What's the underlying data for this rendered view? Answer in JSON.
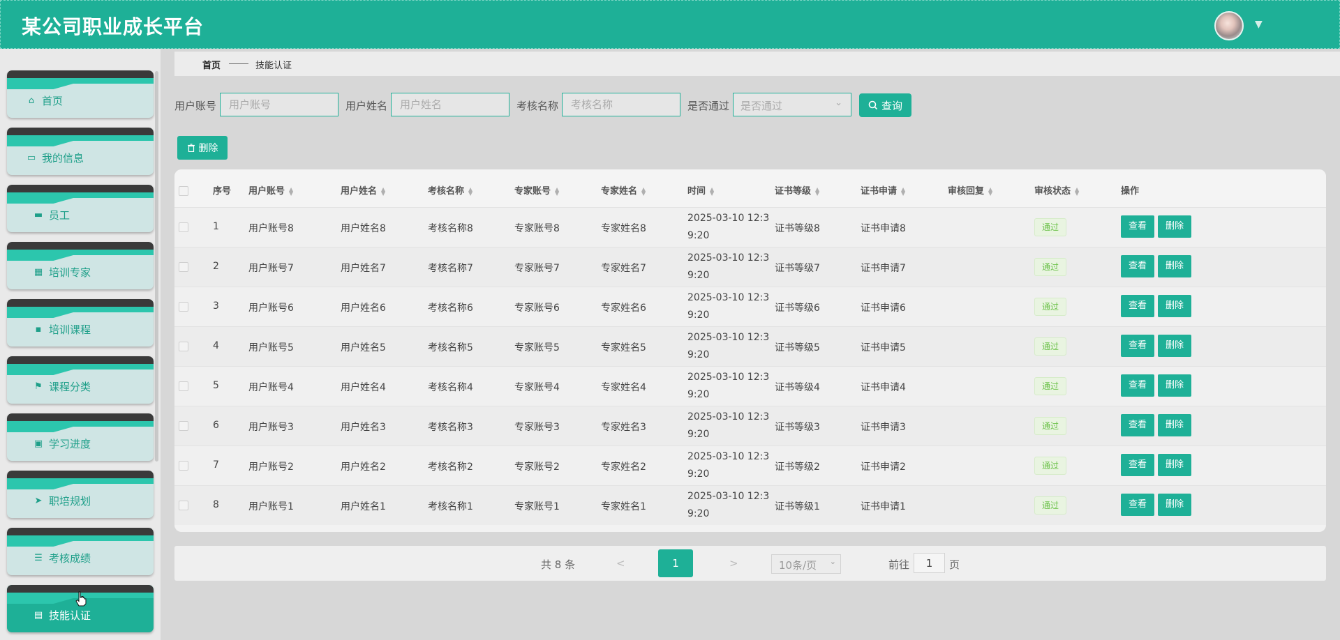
{
  "header": {
    "title": "某公司职业成长平台"
  },
  "sidebar": {
    "items": [
      {
        "label": "首页",
        "icon": "home-icon"
      },
      {
        "label": "我的信息",
        "icon": "wallet-icon"
      },
      {
        "label": "员工",
        "icon": "monitor-icon"
      },
      {
        "label": "培训专家",
        "icon": "grid-icon"
      },
      {
        "label": "培训课程",
        "icon": "apps-icon"
      },
      {
        "label": "课程分类",
        "icon": "flag-icon"
      },
      {
        "label": "学习进度",
        "icon": "clipboard-icon"
      },
      {
        "label": "职培规划",
        "icon": "send-icon"
      },
      {
        "label": "考核成绩",
        "icon": "sliders-icon"
      },
      {
        "label": "技能认证",
        "icon": "document-icon"
      }
    ]
  },
  "breadcrumb": {
    "home": "首页",
    "current": "技能认证"
  },
  "filters": {
    "user_account_label": "用户账号",
    "user_account_placeholder": "用户账号",
    "user_name_label": "用户姓名",
    "user_name_placeholder": "用户姓名",
    "exam_name_label": "考核名称",
    "exam_name_placeholder": "考核名称",
    "passed_label": "是否通过",
    "passed_placeholder": "是否通过",
    "query_label": "查询"
  },
  "toolbar": {
    "delete_label": "删除"
  },
  "table": {
    "columns": [
      "序号",
      "用户账号",
      "用户姓名",
      "考核名称",
      "专家账号",
      "专家姓名",
      "时间",
      "证书等级",
      "证书申请",
      "审核回复",
      "审核状态",
      "操作"
    ],
    "rows": [
      {
        "index": "1",
        "user_account": "用户账号8",
        "user_name": "用户姓名8",
        "exam_name": "考核名称8",
        "expert_account": "专家账号8",
        "expert_name": "专家姓名8",
        "time_a": "2025-03-10 12:3",
        "time_b": "9:20",
        "cert_level": "证书等级8",
        "cert_apply": "证书申请8",
        "reply": "",
        "status": "通过"
      },
      {
        "index": "2",
        "user_account": "用户账号7",
        "user_name": "用户姓名7",
        "exam_name": "考核名称7",
        "expert_account": "专家账号7",
        "expert_name": "专家姓名7",
        "time_a": "2025-03-10 12:3",
        "time_b": "9:20",
        "cert_level": "证书等级7",
        "cert_apply": "证书申请7",
        "reply": "",
        "status": "通过"
      },
      {
        "index": "3",
        "user_account": "用户账号6",
        "user_name": "用户姓名6",
        "exam_name": "考核名称6",
        "expert_account": "专家账号6",
        "expert_name": "专家姓名6",
        "time_a": "2025-03-10 12:3",
        "time_b": "9:20",
        "cert_level": "证书等级6",
        "cert_apply": "证书申请6",
        "reply": "",
        "status": "通过"
      },
      {
        "index": "4",
        "user_account": "用户账号5",
        "user_name": "用户姓名5",
        "exam_name": "考核名称5",
        "expert_account": "专家账号5",
        "expert_name": "专家姓名5",
        "time_a": "2025-03-10 12:3",
        "time_b": "9:20",
        "cert_level": "证书等级5",
        "cert_apply": "证书申请5",
        "reply": "",
        "status": "通过"
      },
      {
        "index": "5",
        "user_account": "用户账号4",
        "user_name": "用户姓名4",
        "exam_name": "考核名称4",
        "expert_account": "专家账号4",
        "expert_name": "专家姓名4",
        "time_a": "2025-03-10 12:3",
        "time_b": "9:20",
        "cert_level": "证书等级4",
        "cert_apply": "证书申请4",
        "reply": "",
        "status": "通过"
      },
      {
        "index": "6",
        "user_account": "用户账号3",
        "user_name": "用户姓名3",
        "exam_name": "考核名称3",
        "expert_account": "专家账号3",
        "expert_name": "专家姓名3",
        "time_a": "2025-03-10 12:3",
        "time_b": "9:20",
        "cert_level": "证书等级3",
        "cert_apply": "证书申请3",
        "reply": "",
        "status": "通过"
      },
      {
        "index": "7",
        "user_account": "用户账号2",
        "user_name": "用户姓名2",
        "exam_name": "考核名称2",
        "expert_account": "专家账号2",
        "expert_name": "专家姓名2",
        "time_a": "2025-03-10 12:3",
        "time_b": "9:20",
        "cert_level": "证书等级2",
        "cert_apply": "证书申请2",
        "reply": "",
        "status": "通过"
      },
      {
        "index": "8",
        "user_account": "用户账号1",
        "user_name": "用户姓名1",
        "exam_name": "考核名称1",
        "expert_account": "专家账号1",
        "expert_name": "专家姓名1",
        "time_a": "2025-03-10 12:3",
        "time_b": "9:20",
        "cert_level": "证书等级1",
        "cert_apply": "证书申请1",
        "reply": "",
        "status": "通过"
      }
    ],
    "view_label": "查看",
    "delete_label": "删除"
  },
  "pagination": {
    "total_text": "共 8 条",
    "prev": "<",
    "next": ">",
    "current_page": "1",
    "page_size": "10条/页",
    "goto_prefix": "前往",
    "goto_value": "1",
    "goto_suffix": "页"
  },
  "colors": {
    "primary": "#1eb097",
    "sidebar_dark": "#3a3a3a",
    "sidebar_teal": "#2cc6ad",
    "status_green": "#6cc24a"
  }
}
